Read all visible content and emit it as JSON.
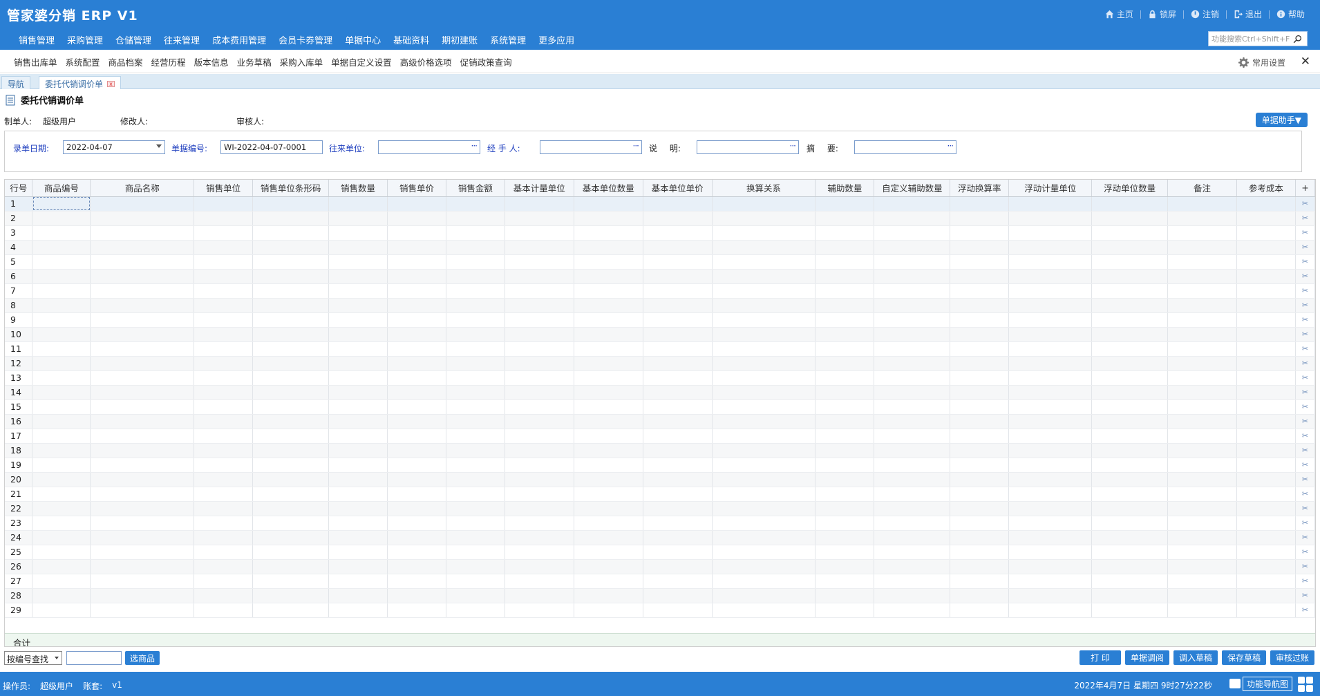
{
  "app": {
    "title": "管家婆分销 ERP V1"
  },
  "top_links": [
    {
      "label": "主页",
      "icon": "home-icon"
    },
    {
      "label": "锁屏",
      "icon": "lock-icon"
    },
    {
      "label": "注销",
      "icon": "power-icon"
    },
    {
      "label": "退出",
      "icon": "exit-icon"
    },
    {
      "label": "帮助",
      "icon": "info-icon"
    }
  ],
  "main_menu": [
    "销售管理",
    "采购管理",
    "仓储管理",
    "往来管理",
    "成本费用管理",
    "会员卡券管理",
    "单据中心",
    "基础资料",
    "期初建账",
    "系统管理",
    "更多应用"
  ],
  "search": {
    "placeholder": "功能搜索Ctrl+Shift+F"
  },
  "subnav": {
    "items": [
      "销售出库单",
      "系统配置",
      "商品档案",
      "经营历程",
      "版本信息",
      "业务草稿",
      "采购入库单",
      "单据自定义设置",
      "高级价格选项",
      "促销政策查询"
    ],
    "settings_label": "常用设置",
    "close": "✕"
  },
  "tabs": [
    {
      "label": "导航"
    },
    {
      "label": "委托代销调价单"
    }
  ],
  "document": {
    "title": "委托代销调价单",
    "meta": {
      "creator_label": "制单人:",
      "creator": "超级用户",
      "modifier_label": "修改人:",
      "modifier": "",
      "auditor_label": "审核人:",
      "auditor": ""
    },
    "helper_button": "单据助手▼"
  },
  "form": {
    "date_label": "录单日期:",
    "date_value": "2022-04-07",
    "number_label": "单据编号:",
    "number_value": "WI-2022-04-07-0001",
    "partner_label": "往来单位:",
    "partner_value": "",
    "handler_label": "经 手 人:",
    "handler_value": "",
    "note_label": "说 明:",
    "note_value": "",
    "summary_label": "摘 要:",
    "summary_value": "",
    "dots": "···"
  },
  "grid": {
    "columns": [
      "行号",
      "商品编号",
      "商品名称",
      "销售单位",
      "销售单位条形码",
      "销售数量",
      "销售单价",
      "销售金额",
      "基本计量单位",
      "基本单位数量",
      "基本单位单价",
      "换算关系",
      "辅助数量",
      "自定义辅助数量",
      "浮动换算率",
      "浮动计量单位",
      "浮动单位数量",
      "备注",
      "参考成本",
      "+"
    ],
    "rows": [
      "1",
      "2",
      "3",
      "4",
      "5",
      "6",
      "7",
      "8",
      "9",
      "10",
      "11",
      "12",
      "13",
      "14",
      "15",
      "16",
      "17",
      "18",
      "19",
      "20",
      "21",
      "22",
      "23",
      "24",
      "25",
      "26",
      "27",
      "28",
      "29"
    ],
    "delete_glyph": "✂",
    "total_label": "合计"
  },
  "bottom": {
    "lookup_mode": "按编号查找",
    "pick_button": "选商品",
    "actions": [
      "打 印",
      "单据调阅",
      "调入草稿",
      "保存草稿",
      "审核过账"
    ]
  },
  "status": {
    "operator_label": "操作员:",
    "operator": "超级用户",
    "account_label": "账套:",
    "account": "v1",
    "datetime": "2022年4月7日  星期四  9时27分22秒",
    "nav_map": "功能导航图"
  },
  "colors": {
    "primary": "#2a7fd4",
    "label_blue": "#1f3fbf"
  }
}
